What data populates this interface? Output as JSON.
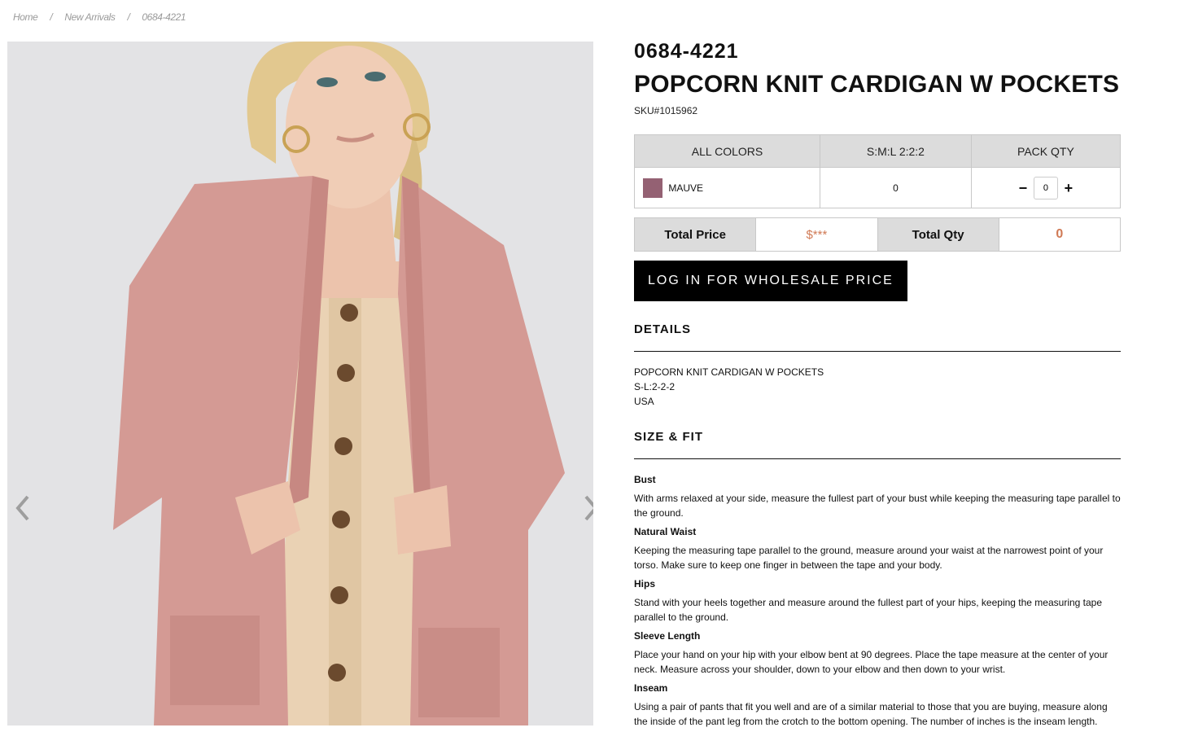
{
  "breadcrumb": {
    "home": "Home",
    "category": "New Arrivals",
    "current": "0684-4221",
    "separator": "/"
  },
  "product": {
    "style_number": "0684-4221",
    "title": "POPCORN KNIT CARDIGAN W POCKETS",
    "sku": "SKU#1015962"
  },
  "matrix": {
    "header_colors": "ALL COLORS",
    "header_size": "S:M:L 2:2:2",
    "header_qty": "PACK QTY",
    "rows": [
      {
        "color_name": "MAUVE",
        "swatch_color": "#946173",
        "pack_count": "0",
        "qty_value": "0"
      }
    ],
    "minus_symbol": "−",
    "plus_symbol": "+"
  },
  "totals": {
    "price_label": "Total Price",
    "price_value": "$***",
    "qty_label": "Total Qty",
    "qty_value": "0"
  },
  "login_button": "LOG IN FOR WHOLESALE PRICE",
  "details": {
    "title": "DETAILS",
    "lines": [
      "POPCORN KNIT CARDIGAN W POCKETS",
      "S-L:2-2-2",
      "USA"
    ]
  },
  "size_fit": {
    "title": "SIZE & FIT",
    "items": [
      {
        "heading": "Bust",
        "text": "With arms relaxed at your side, measure the fullest part of your bust while keeping the measuring tape parallel to the ground."
      },
      {
        "heading": "Natural Waist",
        "text": "Keeping the measuring tape parallel to the ground, measure around your waist at the narrowest point of your torso. Make sure to keep one finger in between the tape and your body."
      },
      {
        "heading": "Hips",
        "text": "Stand with your heels together and measure around the fullest part of your hips, keeping the measuring tape parallel to the ground."
      },
      {
        "heading": "Sleeve Length",
        "text": "Place your hand on your hip with your elbow bent at 90 degrees. Place the tape measure at the center of your neck. Measure across your shoulder, down to your elbow and then down to your wrist."
      },
      {
        "heading": "Inseam",
        "text": "Using a pair of pants that fit you well and are of a similar material to those that you are buying, measure along the inside of the pant leg from the crotch to the bottom opening. The number of inches is the inseam length."
      }
    ]
  },
  "icons": {
    "prev": "chevron-left-icon",
    "next": "chevron-right-icon"
  },
  "colors": {
    "accent_price": "#d07a55",
    "cardigan": "#d49a94",
    "dress": "#ead2b4",
    "button_bg": "#000000"
  }
}
